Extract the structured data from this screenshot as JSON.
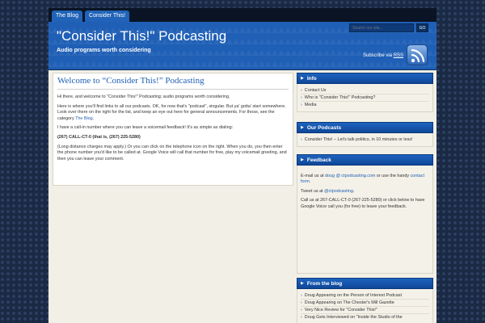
{
  "nav": {
    "tabs": [
      {
        "label": "The Blog"
      },
      {
        "label": "Consider This!"
      }
    ]
  },
  "header": {
    "title": "\"Consider This!\" Podcasting",
    "tagline": "Audio programs worth considering",
    "search_placeholder": "Search our site...",
    "search_button": "GO",
    "subscribe_prefix": "Subscribe via",
    "subscribe_link": "RSS"
  },
  "post": {
    "title": "Welcome to “Consider This!” Podcasting",
    "p1": "Hi there, and welcome to \"Consider This!\" Podcasting; audio programs worth considering.",
    "p2": "Here is where you'll find links to all our podcasts. OK, for now that's \"podcast\", singular. But ya' gotta' start somewhere. Look over there on the right for the list, and keep an eye out here for general announcements. For those, see the category",
    "p2_link": "The Blog",
    "p3": "I have a call-in number where you can leave a voicemail feedback! It's as simple as dialing:",
    "p4": "(267) CALL-CT-0 (that is, (267) 225-5280)",
    "p5": "(Long distance charges may apply.) Or you can click on the telephone icon on the right. When you do, you then enter the phone number you'd like to be called at. Google Voice will call that number for free, play my voicemail greeting, and then you can leave your comment."
  },
  "sidebar": {
    "info": {
      "title": "Info",
      "items": [
        "Contact Us",
        "Who is \"Consider This!\" Podcasting?",
        "Media"
      ]
    },
    "podcasts": {
      "title": "Our Podcasts",
      "items": [
        "Consider This! – Let's talk politics, in 10 minutes or less!"
      ]
    },
    "feedback": {
      "title": "Feedback",
      "email_prefix": "E-mail us at",
      "email_link": "doug @ ctpodcasting.com",
      "email_mid": "or use the handy",
      "contact_link": "contact form",
      "tweet_prefix": "Tweet us at",
      "tweet_link": "@ctpodcasting",
      "call_text": "Call us at 267-CALL-CT-0 (267-225-5280) or click below to have Google Voice call you (for free) to leave your feedback."
    },
    "blog": {
      "title": "From the blog",
      "items": [
        "Doug Appearing on the Person of Interest Podcast",
        "Doug Appearing on The Chester's Mill Gazette",
        "Very Nice Review for \"Consider This!\"",
        "Doug Gets Interviewed on \"Inside the Studio of the"
      ]
    }
  },
  "colors": {
    "accent": "#1f5fb6",
    "background": "#1b2a44",
    "panel": "#f2efe6"
  }
}
